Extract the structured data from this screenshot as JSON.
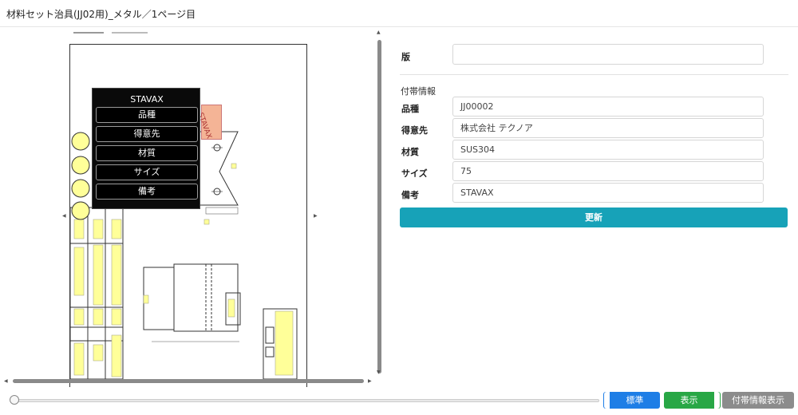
{
  "window": {
    "title": "材料セット治具(JJ02用)_メタル／1ページ目"
  },
  "popup": {
    "title": "STAVAX",
    "items": [
      "品種",
      "得意先",
      "材質",
      "サイズ",
      "備考"
    ]
  },
  "stamp": {
    "text": "STAVAX"
  },
  "form": {
    "version_label": "版",
    "version_value": "",
    "section_title": "付帯情報",
    "fields": [
      {
        "label": "品種",
        "value": "JJ00002"
      },
      {
        "label": "得意先",
        "value": "株式会社 テクノア"
      },
      {
        "label": "材質",
        "value": "SUS304"
      },
      {
        "label": "サイズ",
        "value": "75"
      },
      {
        "label": "備考",
        "value": "STAVAX"
      }
    ],
    "update_label": "更新"
  },
  "bottom": {
    "standard_label": "標準",
    "show_label": "表示",
    "info_show_label": "付帯情報表示"
  },
  "colors": {
    "update": "#17a2b8",
    "standard": "#1e7ee6",
    "show": "#28a745",
    "info": "#8c8c8c",
    "highlight": "#ffff99",
    "stamp": "#f4b496"
  }
}
